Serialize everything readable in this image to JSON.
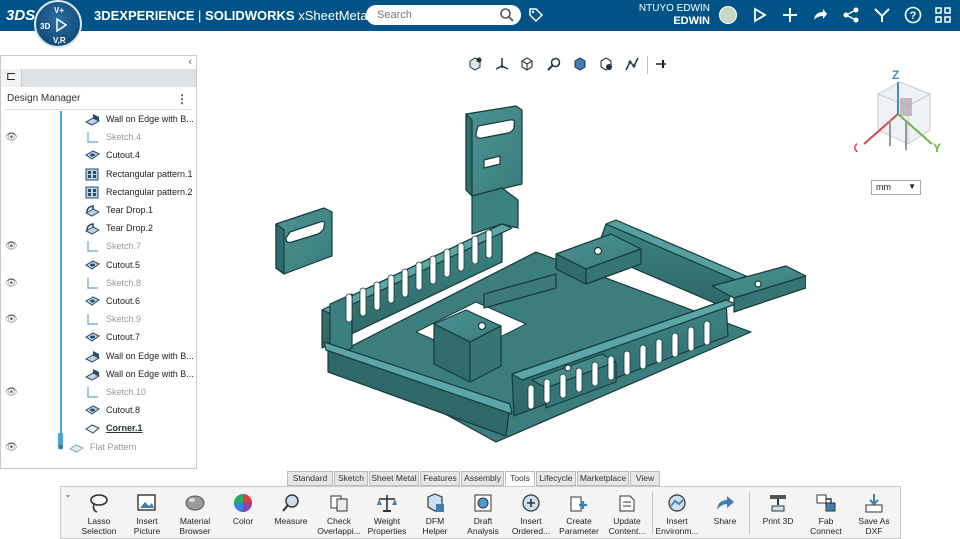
{
  "header": {
    "ds_logo": "3DS",
    "brand_prefix": "3DEXPERIENCE",
    "brand_sep": " | ",
    "brand_app": "SOLIDWORKS",
    "brand_doc": "xSheetMetal",
    "compass_labels": {
      "top": "V+",
      "left": "3D",
      "bottom": "V,R"
    },
    "search_placeholder": "Search",
    "user_line1": "NTUYO EDWIN",
    "user_line2": "EDWIN",
    "icons": [
      "tag-icon",
      "feedback-icon",
      "add-icon",
      "share-icon",
      "network-icon",
      "tools-icon",
      "help-icon",
      "apps-icon"
    ]
  },
  "panel": {
    "collapse_glyph": "‹",
    "tab_glyph": "⊏",
    "title": "Design Manager",
    "menu_glyph": "⋮",
    "items": [
      {
        "label": "Wall on Edge with B...",
        "icon": "wall-edge-icon",
        "dim": false,
        "eye": false
      },
      {
        "label": "Sketch.4",
        "icon": "sketch-icon",
        "dim": true,
        "eye": true
      },
      {
        "label": "Cutout.4",
        "icon": "cutout-icon",
        "dim": false,
        "eye": false
      },
      {
        "label": "Rectangular pattern.1",
        "icon": "pattern-icon",
        "dim": false,
        "eye": false
      },
      {
        "label": "Rectangular pattern.2",
        "icon": "pattern-icon",
        "dim": false,
        "eye": false
      },
      {
        "label": "Tear Drop.1",
        "icon": "teardrop-icon",
        "dim": false,
        "eye": false
      },
      {
        "label": "Tear Drop.2",
        "icon": "teardrop-icon",
        "dim": false,
        "eye": false
      },
      {
        "label": "Sketch.7",
        "icon": "sketch-icon",
        "dim": true,
        "eye": true
      },
      {
        "label": "Cutout.5",
        "icon": "cutout-icon",
        "dim": false,
        "eye": false
      },
      {
        "label": "Sketch.8",
        "icon": "sketch-icon",
        "dim": true,
        "eye": true
      },
      {
        "label": "Cutout.6",
        "icon": "cutout-icon",
        "dim": false,
        "eye": false
      },
      {
        "label": "Sketch.9",
        "icon": "sketch-icon",
        "dim": true,
        "eye": true
      },
      {
        "label": "Cutout.7",
        "icon": "cutout-icon",
        "dim": false,
        "eye": false
      },
      {
        "label": "Wall on Edge with B...",
        "icon": "wall-edge-icon",
        "dim": false,
        "eye": false
      },
      {
        "label": "Wall on Edge with B...",
        "icon": "wall-edge-icon",
        "dim": false,
        "eye": false
      },
      {
        "label": "Sketch.10",
        "icon": "sketch-icon",
        "dim": true,
        "eye": true
      },
      {
        "label": "Cutout.8",
        "icon": "cutout-icon",
        "dim": false,
        "eye": false
      },
      {
        "label": "Corner.1",
        "icon": "corner-icon",
        "dim": false,
        "eye": false,
        "selected": true
      },
      {
        "label": "Flat Pattern",
        "icon": "flat-pattern-icon",
        "dim": true,
        "eye": true,
        "expander": true
      }
    ]
  },
  "viewport": {
    "unit": "mm",
    "triad": {
      "x": "X",
      "y": "Y",
      "z": "Z"
    },
    "view_toolbar": [
      "view-orientation-icon",
      "pan-icon",
      "rotate-icon",
      "zoom-icon",
      "display-style-icon",
      "fit-icon",
      "section-icon",
      "pin-icon"
    ]
  },
  "command_tabs": [
    "Standard",
    "Sketch",
    "Sheet Metal",
    "Features",
    "Assembly",
    "Tools",
    "Lifecycle",
    "Marketplace",
    "View"
  ],
  "active_tab": "Tools",
  "commands": [
    {
      "label1": "Lasso",
      "label2": "Selection"
    },
    {
      "label1": "Insert",
      "label2": "Picture"
    },
    {
      "label1": "Material",
      "label2": "Browser"
    },
    {
      "label1": "Color",
      "label2": ""
    },
    {
      "label1": "Measure",
      "label2": ""
    },
    {
      "label1": "Check",
      "label2": "Overlappi..."
    },
    {
      "label1": "Weight",
      "label2": "Properties"
    },
    {
      "label1": "DFM",
      "label2": "Helper"
    },
    {
      "label1": "Draft",
      "label2": "Analysis"
    },
    {
      "label1": "Insert",
      "label2": "Ordered..."
    },
    {
      "label1": "Create",
      "label2": "Parameter"
    },
    {
      "label1": "Update",
      "label2": "Content..."
    },
    {
      "label1": "Insert",
      "label2": "Environm..."
    },
    {
      "label1": "Share",
      "label2": ""
    },
    {
      "label1": "Print 3D",
      "label2": ""
    },
    {
      "label1": "Fab",
      "label2": "Connect"
    },
    {
      "label1": "Save As",
      "label2": "DXF"
    }
  ],
  "colors": {
    "topbar": "#005386",
    "part": "#3f8585",
    "part_edge": "#173a3a",
    "tree_line": "#4aa3d8"
  }
}
